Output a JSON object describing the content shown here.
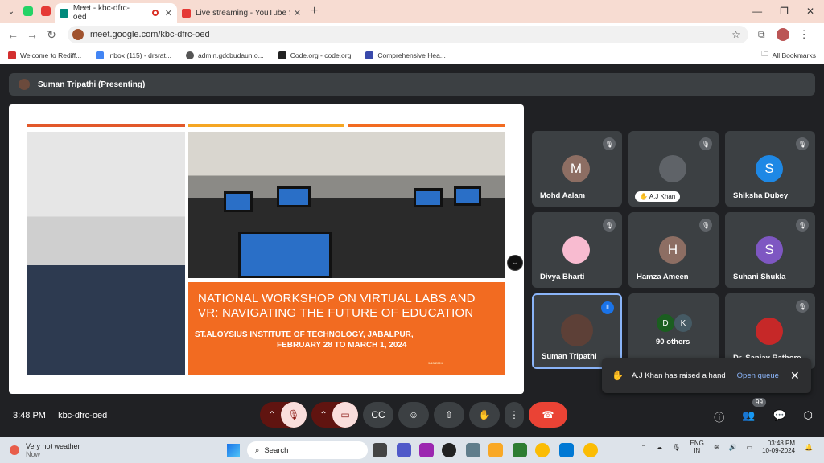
{
  "browser": {
    "tabs": [
      {
        "label": "Meet - kbc-dfrc-oed",
        "active": true
      },
      {
        "label": "Live streaming - YouTube Studio",
        "active": false
      }
    ],
    "url": "meet.google.com/kbc-dfrc-oed",
    "bookmarks": [
      "Welcome to Rediff...",
      "Inbox (115) - drsrat...",
      "admin.gdcbudaun.o...",
      "Code.org - code.org",
      "Comprehensive Hea..."
    ],
    "all_bookmarks": "All Bookmarks"
  },
  "meet": {
    "presenter_bar": "Suman Tripathi (Presenting)",
    "slide": {
      "title_line1": "NATIONAL WORKSHOP ON VIRTUAL LABS AND",
      "title_line2": "VR: NAVIGATING THE FUTURE OF EDUCATION",
      "venue": "ST.ALOYSIUS INSTITUTE OF TECHNOLOGY, JABALPUR,",
      "dates": "FEBRUARY 28 TO MARCH 1, 2024",
      "small": "9/13/2024"
    },
    "participants": [
      {
        "name": "Mohd Aalam",
        "initial": "M",
        "color": "#8d6e63"
      },
      {
        "name": "A.J Khan",
        "initial": "",
        "color": "#5f6368"
      },
      {
        "name": "Shiksha Dubey",
        "initial": "S",
        "color": "#1e88e5"
      },
      {
        "name": "Divya Bharti",
        "initial": "",
        "color": "#f8bbd0"
      },
      {
        "name": "Hamza Ameen",
        "initial": "H",
        "color": "#8d6e63"
      },
      {
        "name": "Suhani Shukla",
        "initial": "S",
        "color": "#7e57c2"
      },
      {
        "name": "Suman Tripathi",
        "initial": "",
        "color": "#5d4037"
      },
      {
        "name": "90 others",
        "initial": "",
        "color": "#3c4043"
      },
      {
        "name": "Dr. Sanjay Rathore",
        "initial": "",
        "color": "#c62828"
      }
    ],
    "others_initials": [
      "D",
      "K"
    ],
    "toast": {
      "text": "A.J Khan has raised a hand",
      "action": "Open queue"
    },
    "time": "3:48 PM",
    "meeting_code": "kbc-dfrc-oed",
    "people_badge": "99"
  },
  "taskbar": {
    "weather": "Very hot weather",
    "weather_sub": "Now",
    "search": "Search",
    "lang": "ENG",
    "region": "IN",
    "time": "03:48 PM",
    "date": "10-09-2024"
  }
}
